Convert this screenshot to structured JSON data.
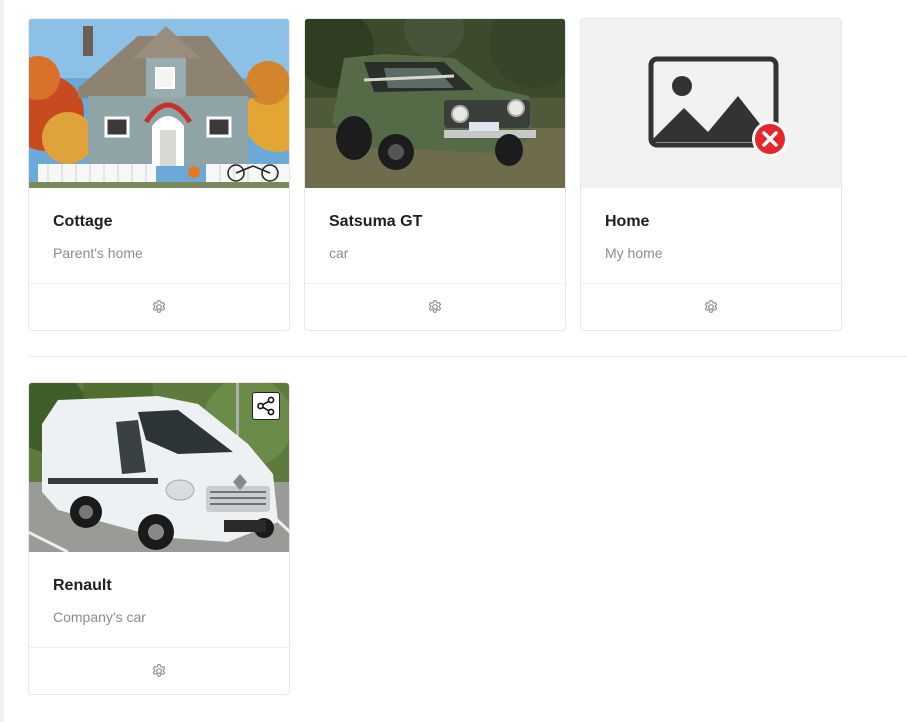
{
  "cards": [
    {
      "title": "Cottage",
      "description": "Parent's home",
      "image": "cottage-house-photo",
      "action_icon": "gear-icon"
    },
    {
      "title": "Satsuma GT",
      "description": "car",
      "image": "green-vintage-car-photo",
      "action_icon": "gear-icon"
    },
    {
      "title": "Home",
      "description": "My home",
      "image": "broken-image-placeholder",
      "action_icon": "gear-icon"
    },
    {
      "title": "Renault",
      "description": "Company's car",
      "image": "white-van-photo",
      "action_icon": "gear-icon",
      "badge_icon": "share-icon"
    }
  ],
  "colors": {
    "title": "#1f1f1f",
    "description": "#8c8c8c",
    "border": "#e8e8e8",
    "error_badge": "#e6262b",
    "placeholder_bg": "#f2f2f2"
  }
}
